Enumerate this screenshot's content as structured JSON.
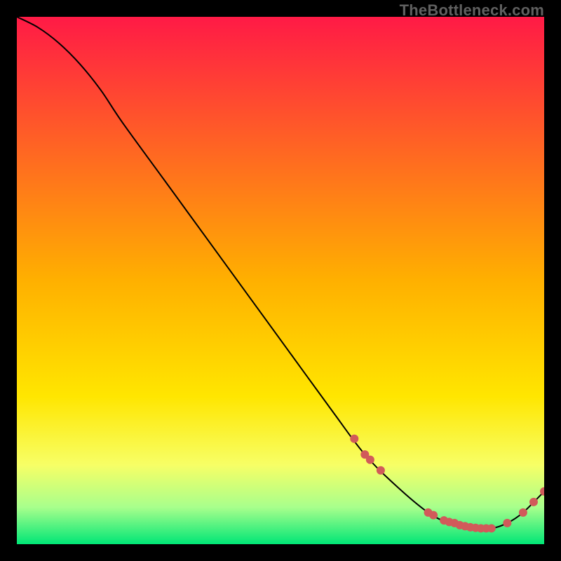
{
  "watermark": "TheBottleneck.com",
  "chart_data": {
    "type": "line",
    "title": "",
    "xlabel": "",
    "ylabel": "",
    "xlim": [
      0,
      100
    ],
    "ylim": [
      0,
      100
    ],
    "background_gradient": {
      "stops": [
        {
          "offset": 0.0,
          "color": "#ff1a46"
        },
        {
          "offset": 0.5,
          "color": "#ffb000"
        },
        {
          "offset": 0.72,
          "color": "#ffe600"
        },
        {
          "offset": 0.85,
          "color": "#f7ff66"
        },
        {
          "offset": 0.93,
          "color": "#a8ff8c"
        },
        {
          "offset": 1.0,
          "color": "#00e676"
        }
      ]
    },
    "series": [
      {
        "name": "bottleneck-curve",
        "stroke": "#000000",
        "stroke_width": 2,
        "x": [
          0,
          4,
          8,
          12,
          16,
          20,
          28,
          36,
          44,
          52,
          60,
          66,
          72,
          78,
          82,
          86,
          90,
          93,
          96,
          100
        ],
        "y": [
          100,
          98,
          95,
          91,
          86,
          80,
          69,
          58,
          47,
          36,
          25,
          17,
          11,
          6,
          4,
          3,
          3,
          4,
          6,
          10
        ]
      }
    ],
    "markers": [
      {
        "name": "highlight-dots",
        "color": "#d15a5a",
        "radius": 6,
        "points": [
          {
            "x": 64,
            "y": 20
          },
          {
            "x": 66,
            "y": 17
          },
          {
            "x": 67,
            "y": 16
          },
          {
            "x": 69,
            "y": 14
          },
          {
            "x": 78,
            "y": 6
          },
          {
            "x": 79,
            "y": 5.5
          },
          {
            "x": 81,
            "y": 4.5
          },
          {
            "x": 82,
            "y": 4.2
          },
          {
            "x": 83,
            "y": 4.0
          },
          {
            "x": 84,
            "y": 3.6
          },
          {
            "x": 85,
            "y": 3.4
          },
          {
            "x": 86,
            "y": 3.2
          },
          {
            "x": 87,
            "y": 3.1
          },
          {
            "x": 88,
            "y": 3.0
          },
          {
            "x": 89,
            "y": 3.0
          },
          {
            "x": 90,
            "y": 3.0
          },
          {
            "x": 93,
            "y": 4.0
          },
          {
            "x": 96,
            "y": 6.0
          },
          {
            "x": 98,
            "y": 8.0
          },
          {
            "x": 100,
            "y": 10.0
          }
        ]
      }
    ]
  }
}
